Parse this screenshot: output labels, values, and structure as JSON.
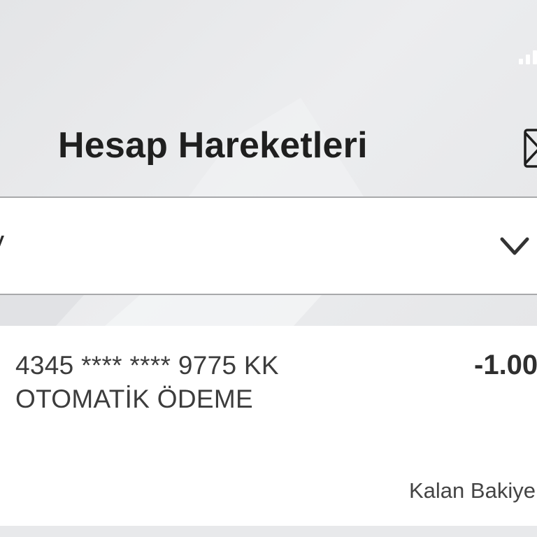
{
  "header": {
    "title": "Hesap Hareketleri",
    "mail_icon": "mail-icon",
    "signal_icon": "signal-icon"
  },
  "account_select": {
    "value": "y",
    "icon": "chevron-down-icon"
  },
  "transaction": {
    "line1": "4345 **** **** 9775 KK",
    "line2": "OTOMATİK ÖDEME",
    "amount": "-1.00",
    "balance_label": "Kalan Bakiye"
  },
  "colors": {
    "background": "#e6e7e9",
    "card": "#ffffff",
    "divider": "#a8a9ab",
    "text": "#2b2b2b"
  }
}
